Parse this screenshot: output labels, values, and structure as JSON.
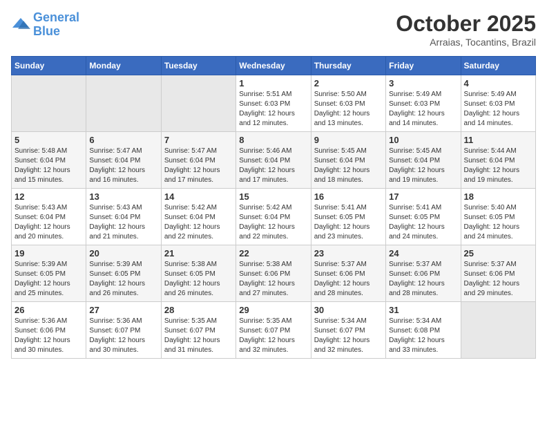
{
  "header": {
    "logo_line1": "General",
    "logo_line2": "Blue",
    "month": "October 2025",
    "location": "Arraias, Tocantins, Brazil"
  },
  "weekdays": [
    "Sunday",
    "Monday",
    "Tuesday",
    "Wednesday",
    "Thursday",
    "Friday",
    "Saturday"
  ],
  "weeks": [
    [
      {
        "day": "",
        "sunrise": "",
        "sunset": "",
        "daylight": ""
      },
      {
        "day": "",
        "sunrise": "",
        "sunset": "",
        "daylight": ""
      },
      {
        "day": "",
        "sunrise": "",
        "sunset": "",
        "daylight": ""
      },
      {
        "day": "1",
        "sunrise": "Sunrise: 5:51 AM",
        "sunset": "Sunset: 6:03 PM",
        "daylight": "Daylight: 12 hours and 12 minutes."
      },
      {
        "day": "2",
        "sunrise": "Sunrise: 5:50 AM",
        "sunset": "Sunset: 6:03 PM",
        "daylight": "Daylight: 12 hours and 13 minutes."
      },
      {
        "day": "3",
        "sunrise": "Sunrise: 5:49 AM",
        "sunset": "Sunset: 6:03 PM",
        "daylight": "Daylight: 12 hours and 14 minutes."
      },
      {
        "day": "4",
        "sunrise": "Sunrise: 5:49 AM",
        "sunset": "Sunset: 6:03 PM",
        "daylight": "Daylight: 12 hours and 14 minutes."
      }
    ],
    [
      {
        "day": "5",
        "sunrise": "Sunrise: 5:48 AM",
        "sunset": "Sunset: 6:04 PM",
        "daylight": "Daylight: 12 hours and 15 minutes."
      },
      {
        "day": "6",
        "sunrise": "Sunrise: 5:47 AM",
        "sunset": "Sunset: 6:04 PM",
        "daylight": "Daylight: 12 hours and 16 minutes."
      },
      {
        "day": "7",
        "sunrise": "Sunrise: 5:47 AM",
        "sunset": "Sunset: 6:04 PM",
        "daylight": "Daylight: 12 hours and 17 minutes."
      },
      {
        "day": "8",
        "sunrise": "Sunrise: 5:46 AM",
        "sunset": "Sunset: 6:04 PM",
        "daylight": "Daylight: 12 hours and 17 minutes."
      },
      {
        "day": "9",
        "sunrise": "Sunrise: 5:45 AM",
        "sunset": "Sunset: 6:04 PM",
        "daylight": "Daylight: 12 hours and 18 minutes."
      },
      {
        "day": "10",
        "sunrise": "Sunrise: 5:45 AM",
        "sunset": "Sunset: 6:04 PM",
        "daylight": "Daylight: 12 hours and 19 minutes."
      },
      {
        "day": "11",
        "sunrise": "Sunrise: 5:44 AM",
        "sunset": "Sunset: 6:04 PM",
        "daylight": "Daylight: 12 hours and 19 minutes."
      }
    ],
    [
      {
        "day": "12",
        "sunrise": "Sunrise: 5:43 AM",
        "sunset": "Sunset: 6:04 PM",
        "daylight": "Daylight: 12 hours and 20 minutes."
      },
      {
        "day": "13",
        "sunrise": "Sunrise: 5:43 AM",
        "sunset": "Sunset: 6:04 PM",
        "daylight": "Daylight: 12 hours and 21 minutes."
      },
      {
        "day": "14",
        "sunrise": "Sunrise: 5:42 AM",
        "sunset": "Sunset: 6:04 PM",
        "daylight": "Daylight: 12 hours and 22 minutes."
      },
      {
        "day": "15",
        "sunrise": "Sunrise: 5:42 AM",
        "sunset": "Sunset: 6:04 PM",
        "daylight": "Daylight: 12 hours and 22 minutes."
      },
      {
        "day": "16",
        "sunrise": "Sunrise: 5:41 AM",
        "sunset": "Sunset: 6:05 PM",
        "daylight": "Daylight: 12 hours and 23 minutes."
      },
      {
        "day": "17",
        "sunrise": "Sunrise: 5:41 AM",
        "sunset": "Sunset: 6:05 PM",
        "daylight": "Daylight: 12 hours and 24 minutes."
      },
      {
        "day": "18",
        "sunrise": "Sunrise: 5:40 AM",
        "sunset": "Sunset: 6:05 PM",
        "daylight": "Daylight: 12 hours and 24 minutes."
      }
    ],
    [
      {
        "day": "19",
        "sunrise": "Sunrise: 5:39 AM",
        "sunset": "Sunset: 6:05 PM",
        "daylight": "Daylight: 12 hours and 25 minutes."
      },
      {
        "day": "20",
        "sunrise": "Sunrise: 5:39 AM",
        "sunset": "Sunset: 6:05 PM",
        "daylight": "Daylight: 12 hours and 26 minutes."
      },
      {
        "day": "21",
        "sunrise": "Sunrise: 5:38 AM",
        "sunset": "Sunset: 6:05 PM",
        "daylight": "Daylight: 12 hours and 26 minutes."
      },
      {
        "day": "22",
        "sunrise": "Sunrise: 5:38 AM",
        "sunset": "Sunset: 6:06 PM",
        "daylight": "Daylight: 12 hours and 27 minutes."
      },
      {
        "day": "23",
        "sunrise": "Sunrise: 5:37 AM",
        "sunset": "Sunset: 6:06 PM",
        "daylight": "Daylight: 12 hours and 28 minutes."
      },
      {
        "day": "24",
        "sunrise": "Sunrise: 5:37 AM",
        "sunset": "Sunset: 6:06 PM",
        "daylight": "Daylight: 12 hours and 28 minutes."
      },
      {
        "day": "25",
        "sunrise": "Sunrise: 5:37 AM",
        "sunset": "Sunset: 6:06 PM",
        "daylight": "Daylight: 12 hours and 29 minutes."
      }
    ],
    [
      {
        "day": "26",
        "sunrise": "Sunrise: 5:36 AM",
        "sunset": "Sunset: 6:06 PM",
        "daylight": "Daylight: 12 hours and 30 minutes."
      },
      {
        "day": "27",
        "sunrise": "Sunrise: 5:36 AM",
        "sunset": "Sunset: 6:07 PM",
        "daylight": "Daylight: 12 hours and 30 minutes."
      },
      {
        "day": "28",
        "sunrise": "Sunrise: 5:35 AM",
        "sunset": "Sunset: 6:07 PM",
        "daylight": "Daylight: 12 hours and 31 minutes."
      },
      {
        "day": "29",
        "sunrise": "Sunrise: 5:35 AM",
        "sunset": "Sunset: 6:07 PM",
        "daylight": "Daylight: 12 hours and 32 minutes."
      },
      {
        "day": "30",
        "sunrise": "Sunrise: 5:34 AM",
        "sunset": "Sunset: 6:07 PM",
        "daylight": "Daylight: 12 hours and 32 minutes."
      },
      {
        "day": "31",
        "sunrise": "Sunrise: 5:34 AM",
        "sunset": "Sunset: 6:08 PM",
        "daylight": "Daylight: 12 hours and 33 minutes."
      },
      {
        "day": "",
        "sunrise": "",
        "sunset": "",
        "daylight": ""
      }
    ]
  ]
}
